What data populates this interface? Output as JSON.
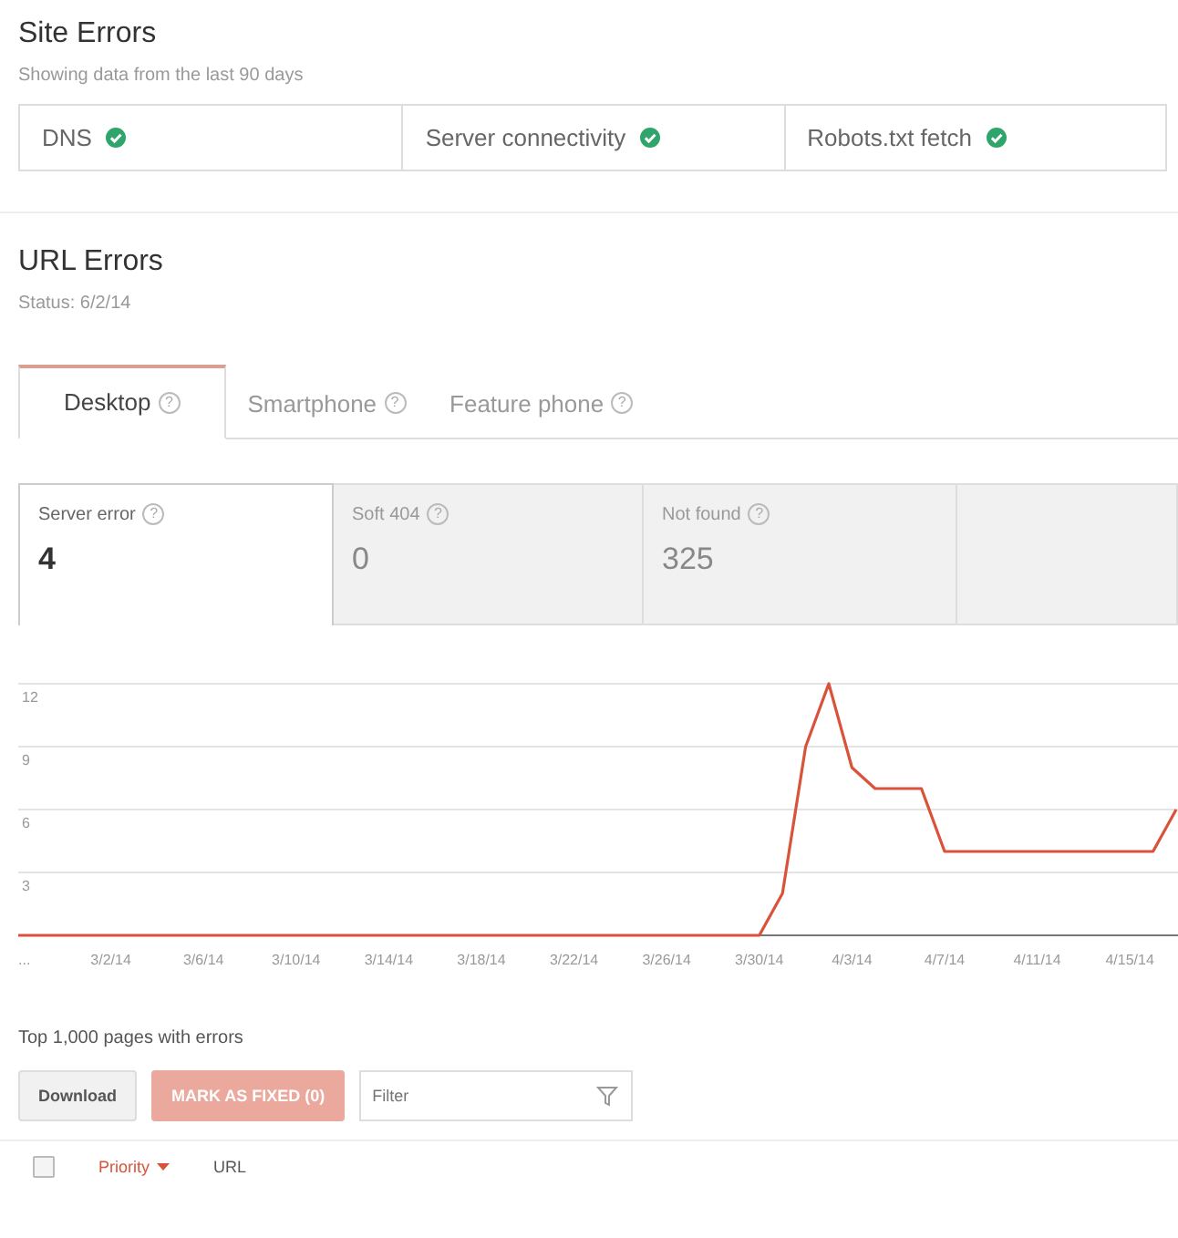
{
  "site_errors": {
    "title": "Site Errors",
    "subtitle": "Showing data from the last 90 days",
    "checks": [
      {
        "label": "DNS",
        "ok": true
      },
      {
        "label": "Server connectivity",
        "ok": true
      },
      {
        "label": "Robots.txt fetch",
        "ok": true
      }
    ]
  },
  "url_errors": {
    "title": "URL Errors",
    "status": "Status: 6/2/14",
    "tabs": [
      {
        "label": "Desktop",
        "help": "?",
        "selected": true
      },
      {
        "label": "Smartphone",
        "help": "?",
        "selected": false
      },
      {
        "label": "Feature phone",
        "help": "?",
        "selected": false
      }
    ],
    "metrics": [
      {
        "label": "Server error",
        "help": "?",
        "value": "4",
        "selected": true
      },
      {
        "label": "Soft 404",
        "help": "?",
        "value": "0",
        "selected": false
      },
      {
        "label": "Not found",
        "help": "?",
        "value": "325",
        "selected": false
      }
    ],
    "chart_data": {
      "type": "line",
      "ylim": [
        0,
        12
      ],
      "grid": true,
      "categories": [
        "...",
        null,
        null,
        null,
        "3/2/14",
        null,
        null,
        null,
        "3/6/14",
        null,
        null,
        null,
        "3/10/14",
        null,
        null,
        null,
        "3/14/14",
        null,
        null,
        null,
        "3/18/14",
        null,
        null,
        null,
        "3/22/14",
        null,
        null,
        null,
        "3/26/14",
        null,
        null,
        null,
        "3/30/14",
        null,
        null,
        null,
        "4/3/14",
        null,
        null,
        null,
        "4/7/14",
        null,
        null,
        null,
        "4/11/14",
        null,
        null,
        null,
        "4/15/14",
        null,
        null
      ],
      "series": [
        {
          "color": "#d9533b",
          "values": [
            0,
            0,
            0,
            0,
            0,
            0,
            0,
            0,
            0,
            0,
            0,
            0,
            0,
            0,
            0,
            0,
            0,
            0,
            0,
            0,
            0,
            0,
            0,
            0,
            0,
            0,
            0,
            0,
            0,
            0,
            0,
            0,
            0,
            2,
            9,
            12,
            8,
            7,
            7,
            7,
            4,
            4,
            4,
            4,
            4,
            4,
            4,
            4,
            4,
            4,
            6
          ]
        }
      ],
      "yticks": [
        3,
        6,
        9,
        12
      ]
    }
  },
  "pages": {
    "title": "Top 1,000 pages with errors",
    "download": "Download",
    "mark_fixed": {
      "label": "MARK AS FIXED (0)",
      "disabled": true
    },
    "filter": {
      "placeholder": "Filter"
    },
    "select_all": {
      "checked": false
    },
    "columns": [
      {
        "label": "Priority",
        "sorted": true
      },
      {
        "label": "URL",
        "sorted": false
      }
    ]
  }
}
